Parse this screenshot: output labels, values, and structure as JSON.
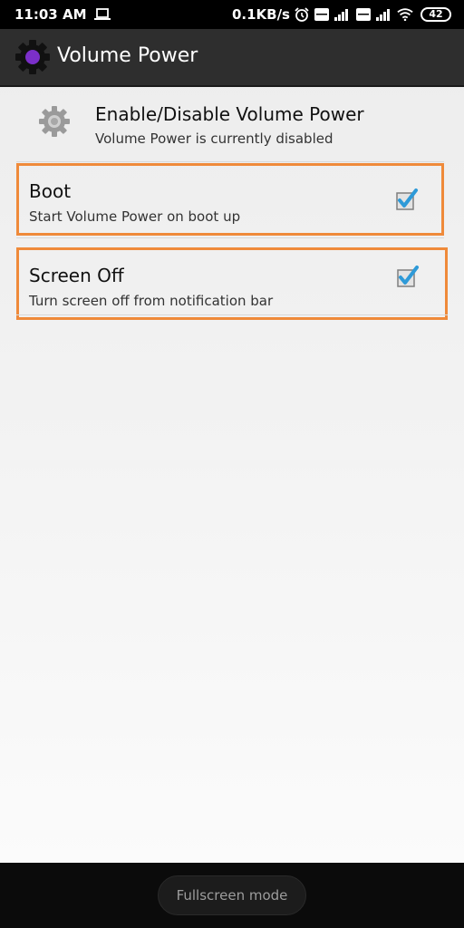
{
  "status_bar": {
    "time": "11:03 AM",
    "network_speed": "0.1KB/s",
    "battery_level": "42",
    "icons": [
      "laptop-icon",
      "alarm-icon",
      "volte-icon",
      "signal-icon",
      "volte-icon",
      "signal-icon",
      "wifi-icon",
      "battery-icon"
    ]
  },
  "app_bar": {
    "title": "Volume Power",
    "logo_icon": "gear-logo-icon",
    "accent_color": "#7b2fc9"
  },
  "preferences": {
    "master": {
      "title": "Enable/Disable Volume Power",
      "summary": "Volume Power is currently disabled",
      "icon": "gear-icon"
    },
    "boot": {
      "title": "Boot",
      "summary": "Start Volume Power on boot up",
      "checked": true
    },
    "screen_off": {
      "title": "Screen Off",
      "summary": "Turn screen off from notification bar",
      "checked": true
    }
  },
  "highlight_color": "#ef8a3a",
  "nav_bar": {
    "fullscreen_label": "Fullscreen mode"
  }
}
